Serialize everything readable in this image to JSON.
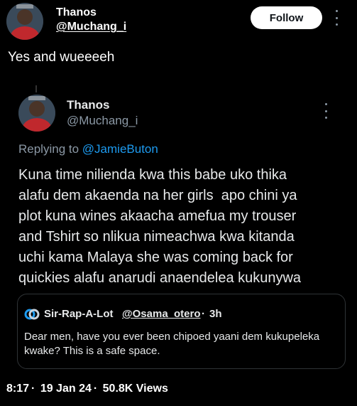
{
  "post": {
    "author_name": "Thanos",
    "author_handle": "@Muchang_i",
    "follow_label": "Follow",
    "text": "Yes and wueeeeh"
  },
  "quoted_tweet": {
    "author_name": "Thanos",
    "author_handle": "@Muchang_i",
    "replying_prefix": "Replying to",
    "replying_to": "@JamieButon",
    "lines": [
      "Kuna time nilienda kwa this babe uko thika",
      "alafu dem akaenda na her girls  apo chini ya",
      "plot kuna wines akaacha amefua my trouser",
      "and Tshirt so nlikua nimeachwa kwa kitanda",
      "uchi kama Malaya she was coming back for",
      "quickies alafu anarudi anaendelea kukunywa"
    ]
  },
  "nested_quote": {
    "author_name": "Sir-Rap-A-Lot",
    "author_handle": "@Osama_otero",
    "separator": "·",
    "time": "3h",
    "text": "Dear men, have you ever been chipoed yaani dem kukupeleka kwake? This is a safe space."
  },
  "meta": {
    "time": "8:17",
    "date": "19 Jan 24",
    "views": "50.8K Views",
    "separator": "·"
  },
  "icons": {
    "more": "more-vertical-icon",
    "nested_avatar": "overlapping-circles-icon"
  },
  "colors": {
    "background": "#000000",
    "link": "#1d9bf0",
    "secondary_text": "#8b98a5",
    "border": "#2f3336"
  }
}
